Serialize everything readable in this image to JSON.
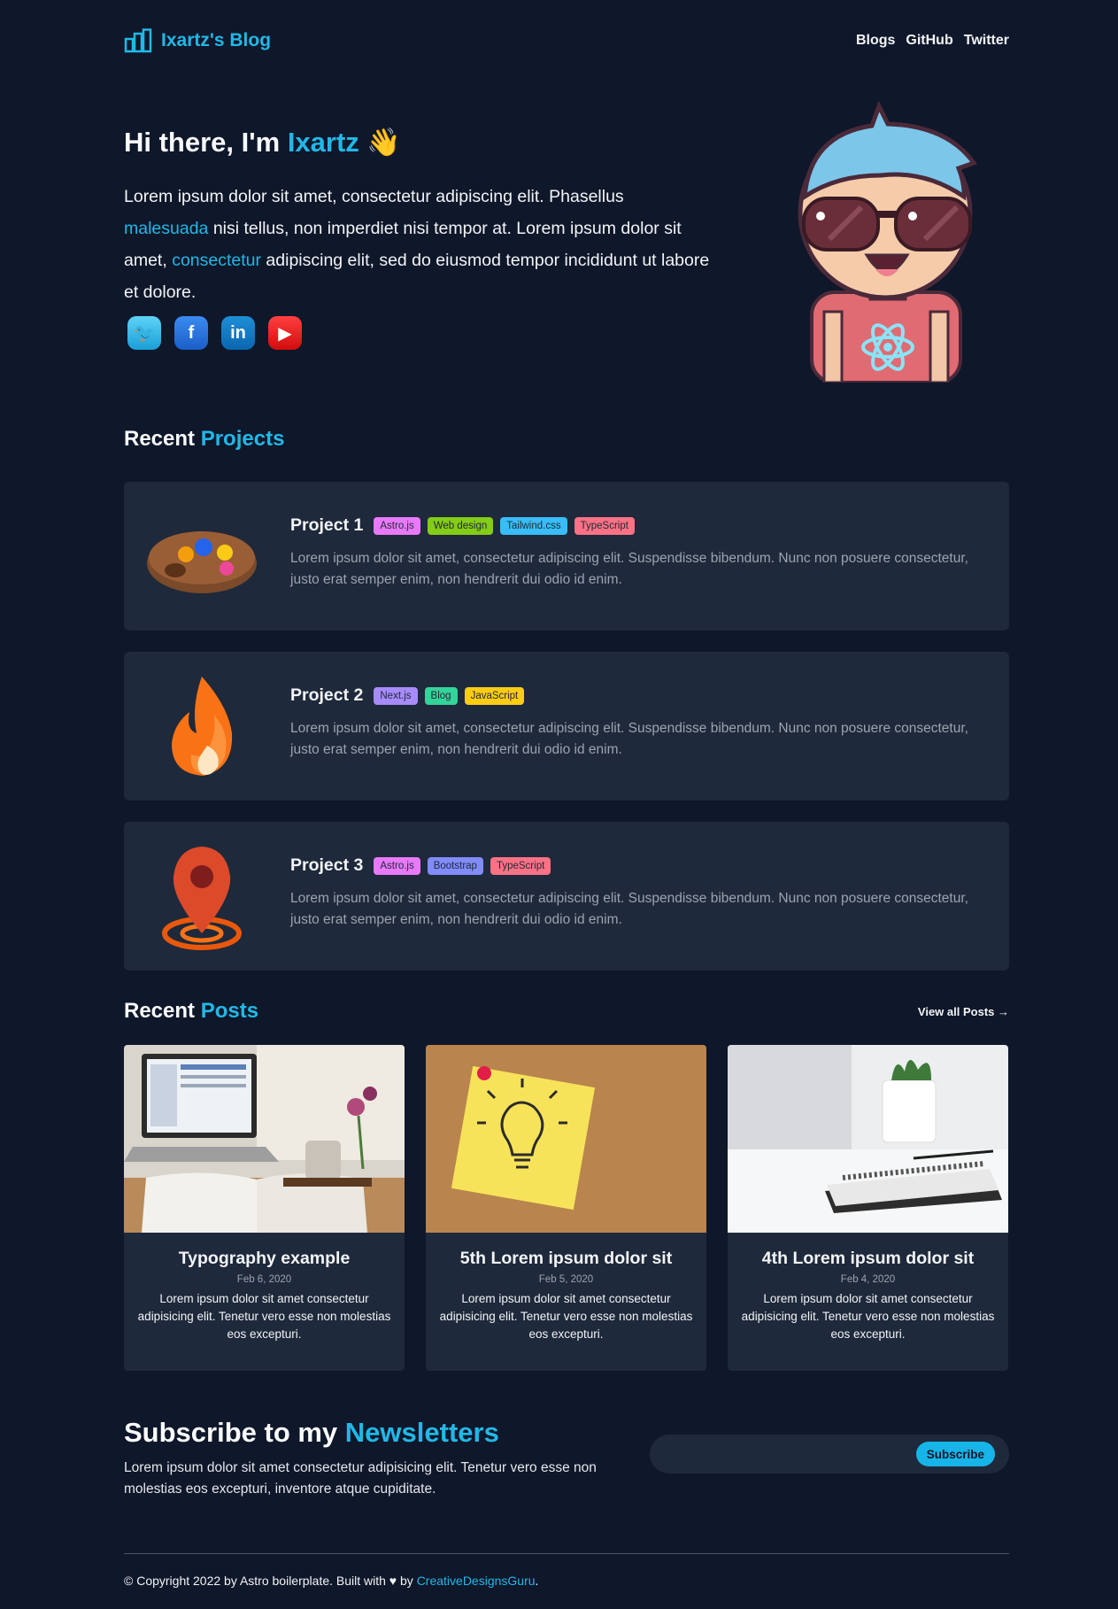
{
  "header": {
    "brand": "Ixartz's Blog",
    "nav": [
      "Blogs",
      "GitHub",
      "Twitter"
    ]
  },
  "hero": {
    "greeting": "Hi there, I'm ",
    "name": "Ixartz",
    "wave": "👋",
    "text_1": "Lorem ipsum dolor sit amet, consectetur adipiscing elit. Phasellus ",
    "link_1": "malesuada",
    "text_2": " nisi tellus, non imperdiet nisi tempor at. Lorem ipsum dolor sit amet, ",
    "link_2": "consectetur",
    "text_3": " adipiscing elit, sed do eiusmod tempor incididunt ut labore et dolore.",
    "socials": [
      {
        "icon": "twitter-icon",
        "glyph": "🐦"
      },
      {
        "icon": "facebook-icon",
        "glyph": "f"
      },
      {
        "icon": "linkedin-icon",
        "glyph": "in"
      },
      {
        "icon": "youtube-icon",
        "glyph": "▶"
      }
    ]
  },
  "projects": {
    "title_plain": "Recent ",
    "title_accent": "Projects",
    "items": [
      {
        "name": "Project 1",
        "icon": "palette-icon",
        "tags": [
          {
            "label": "Astro.js",
            "color": "#e879f9"
          },
          {
            "label": "Web design",
            "color": "#84cc16"
          },
          {
            "label": "Tailwind.css",
            "color": "#38bdf8"
          },
          {
            "label": "TypeScript",
            "color": "#fb7185"
          }
        ],
        "description": "Lorem ipsum dolor sit amet, consectetur adipiscing elit. Suspendisse bibendum. Nunc non posuere consectetur, justo erat semper enim, non hendrerit dui odio id enim."
      },
      {
        "name": "Project 2",
        "icon": "fire-icon",
        "tags": [
          {
            "label": "Next.js",
            "color": "#a78bfa"
          },
          {
            "label": "Blog",
            "color": "#34d399"
          },
          {
            "label": "JavaScript",
            "color": "#facc15"
          }
        ],
        "description": "Lorem ipsum dolor sit amet, consectetur adipiscing elit. Suspendisse bibendum. Nunc non posuere consectetur, justo erat semper enim, non hendrerit dui odio id enim."
      },
      {
        "name": "Project 3",
        "icon": "map-pin-icon",
        "tags": [
          {
            "label": "Astro.js",
            "color": "#e879f9"
          },
          {
            "label": "Bootstrap",
            "color": "#818cf8"
          },
          {
            "label": "TypeScript",
            "color": "#fb7185"
          }
        ],
        "description": "Lorem ipsum dolor sit amet, consectetur adipiscing elit. Suspendisse bibendum. Nunc non posuere consectetur, justo erat semper enim, non hendrerit dui odio id enim."
      }
    ]
  },
  "posts": {
    "title_plain": "Recent ",
    "title_accent": "Posts",
    "view_all": "View all Posts →",
    "items": [
      {
        "title": "Typography example",
        "date": "Feb 6, 2020",
        "description": "Lorem ipsum dolor sit amet consectetur adipisicing elit. Tenetur vero esse non molestias eos excepturi."
      },
      {
        "title": "5th Lorem ipsum dolor sit",
        "date": "Feb 5, 2020",
        "description": "Lorem ipsum dolor sit amet consectetur adipisicing elit. Tenetur vero esse non molestias eos excepturi."
      },
      {
        "title": "4th Lorem ipsum dolor sit",
        "date": "Feb 4, 2020",
        "description": "Lorem ipsum dolor sit amet consectetur adipisicing elit. Tenetur vero esse non molestias eos excepturi."
      }
    ]
  },
  "newsletter": {
    "title_plain": "Subscribe to my ",
    "title_accent": "Newsletters",
    "text": "Lorem ipsum dolor sit amet consectetur adipisicing elit. Tenetur vero esse non molestias eos excepturi, inventore atque cupiditate.",
    "input_value": "",
    "button": "Subscribe"
  },
  "footer": {
    "text": "© Copyright 2022 by Astro boilerplate. Built with ♥ by ",
    "link": "CreativeDesignsGuru",
    "suffix": "."
  },
  "colors": {
    "background": "#0f172a",
    "card": "#1e293b",
    "accent": "#22b8e6"
  }
}
